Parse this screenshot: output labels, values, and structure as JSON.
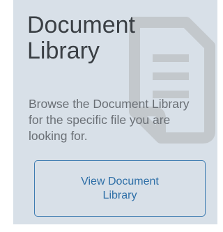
{
  "card": {
    "title": "Document Library",
    "description": "Browse the Document Library for the specific file you are looking for.",
    "button_label": "View Document Library",
    "icon": "document-icon"
  },
  "colors": {
    "card_background": "#d8e0e8",
    "title": "#3a3f44",
    "description": "#6a6f75",
    "accent": "#2e6fa7",
    "icon": "#c3c8cc"
  }
}
